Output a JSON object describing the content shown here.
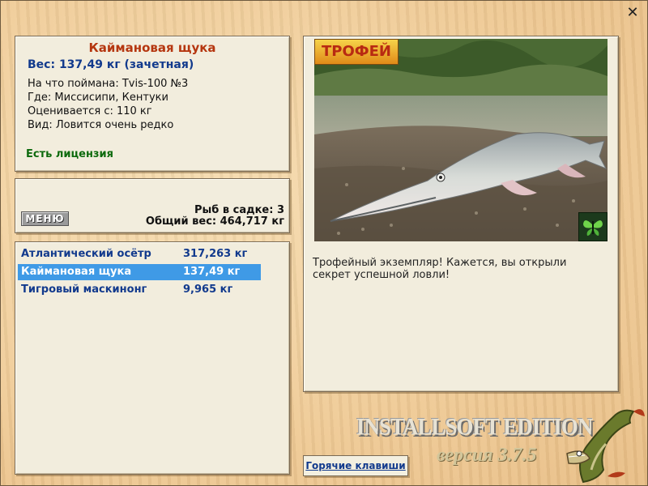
{
  "window": {
    "close_icon": "close-icon"
  },
  "info": {
    "fish_name": "Каймановая щука",
    "weight_line": "Вес: 137,49 кг (зачетная)",
    "details": [
      "На что поймана: Tvis-100 №3",
      "Где: Миссисипи, Кентуки",
      "Оценивается с: 110 кг",
      "Вид: Ловится очень редко"
    ],
    "license": "Есть лицензия"
  },
  "cage": {
    "menu_label": "МЕНЮ",
    "fish_count": "Рыб в садке: 3",
    "total_weight": "Общий вес: 464,717 кг"
  },
  "catch_list": [
    {
      "name": "Атлантический осётр",
      "weight": "317,263 кг"
    },
    {
      "name": "Каймановая щука",
      "weight": "137,49 кг"
    },
    {
      "name": "Тигровый маскинонг",
      "weight": "9,965 кг"
    }
  ],
  "selected_index": 1,
  "photo": {
    "badge": "ТРОФЕЙ",
    "corner_icon": "butterfly-icon"
  },
  "description": "Трофейный экземпляр! Кажется, вы открыли секрет успешной ловли!",
  "hotkeys_label": "Горячие клавиши",
  "brand": {
    "title": "INSTALLSOFT EDITION",
    "version": "версия 3.7.5"
  },
  "colors": {
    "fish_name": "#b5360f",
    "weight": "#123a8d",
    "license": "#0d6a0d",
    "selection": "#3f9ae6",
    "background": "#f1cf9c"
  }
}
